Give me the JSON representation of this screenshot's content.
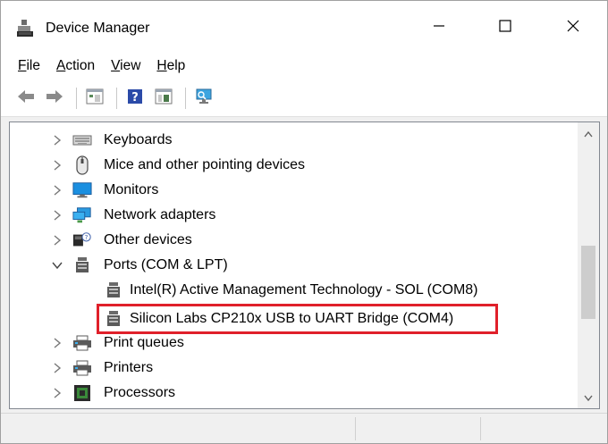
{
  "window": {
    "title": "Device Manager",
    "icons": {
      "app": "device-manager-icon",
      "minimize": "minimize-icon",
      "maximize": "maximize-icon",
      "close": "close-icon"
    }
  },
  "menu": {
    "file": {
      "accel": "F",
      "rest": "ile"
    },
    "action": {
      "accel": "A",
      "rest": "ction"
    },
    "view": {
      "accel": "V",
      "rest": "iew"
    },
    "help": {
      "accel": "H",
      "rest": "elp"
    }
  },
  "toolbar": {
    "buttons": [
      "back-arrow-icon",
      "forward-arrow-icon",
      "properties-icon",
      "help-icon",
      "show-hidden-icon",
      "scan-hardware-icon"
    ]
  },
  "tree": {
    "items": [
      {
        "label": "Keyboards",
        "icon": "keyboard-icon",
        "expanded": false
      },
      {
        "label": "Mice and other pointing devices",
        "icon": "mouse-icon",
        "expanded": false
      },
      {
        "label": "Monitors",
        "icon": "monitor-icon",
        "expanded": false
      },
      {
        "label": "Network adapters",
        "icon": "network-adapter-icon",
        "expanded": false
      },
      {
        "label": "Other devices",
        "icon": "unknown-device-icon",
        "expanded": false
      },
      {
        "label": "Ports (COM & LPT)",
        "icon": "port-icon",
        "expanded": true
      },
      {
        "label": "Intel(R) Active Management Technology - SOL (COM8)",
        "icon": "port-icon",
        "child": true
      },
      {
        "label": "Silicon Labs CP210x USB to UART Bridge (COM4)",
        "icon": "port-icon",
        "child": true,
        "highlighted": true
      },
      {
        "label": "Print queues",
        "icon": "printer-icon",
        "expanded": false
      },
      {
        "label": "Printers",
        "icon": "printer-icon",
        "expanded": false
      },
      {
        "label": "Processors",
        "icon": "processor-icon",
        "expanded": false
      }
    ]
  },
  "colors": {
    "highlight": "#e0202a",
    "accent": "#0078d7"
  }
}
